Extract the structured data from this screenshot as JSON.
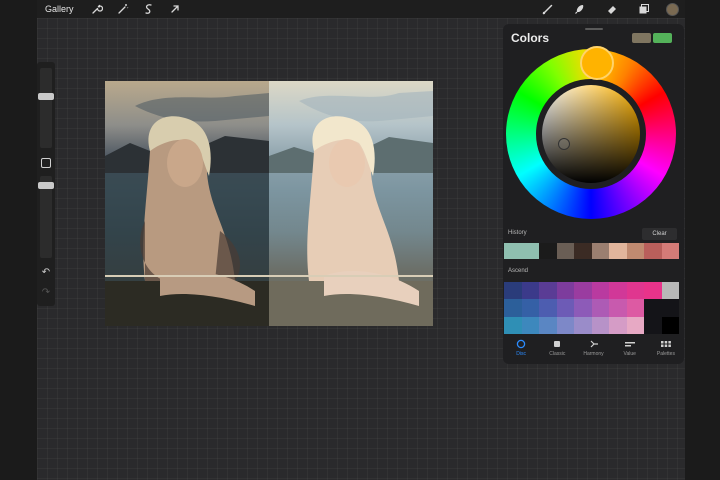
{
  "topbar": {
    "gallery_label": "Gallery",
    "left_tools": [
      {
        "name": "wrench-icon"
      },
      {
        "name": "magic-wand-icon"
      },
      {
        "name": "selection-icon"
      },
      {
        "name": "transform-arrow-icon"
      }
    ],
    "right_tools": [
      {
        "name": "brush-icon"
      },
      {
        "name": "smudge-icon"
      },
      {
        "name": "eraser-icon"
      },
      {
        "name": "layers-icon"
      }
    ],
    "current_color": "#7a6a52"
  },
  "sidebar": {
    "brush_size_icon": "slider-knob",
    "modify_icon": "square-icon",
    "undo_glyph": "↶",
    "redo_glyph": "↷"
  },
  "colors_panel": {
    "title": "Colors",
    "current_primary": "#7f7560",
    "current_secondary": "#54b25a",
    "hue_color": "#ffb300",
    "history_label": "History",
    "clear_label": "Clear",
    "history": [
      "#8fbfb0",
      "#8fbfb0",
      "#1b1b1b",
      "#6a5e55",
      "#3b2b24",
      "#9b7f70",
      "#e1b59c",
      "#c08a70",
      "#b95f5b",
      "#d47b77"
    ],
    "palette_label": "Ascend",
    "palette": [
      "#2a3c7a",
      "#3b3a8a",
      "#5a3c95",
      "#7d3c9d",
      "#9a3ca0",
      "#b93aa0",
      "#d13898",
      "#e0368f",
      "#e8338a",
      "#b8b8b8",
      "#2c5f9a",
      "#3560a6",
      "#4d5db0",
      "#6d5bb6",
      "#8d5bb8",
      "#ad5bb5",
      "#c85aae",
      "#dd5aa3",
      "#141418",
      "#141418",
      "#2f8fb5",
      "#3d88bd",
      "#5a86c3",
      "#7d88c8",
      "#9a8cc9",
      "#b792c8",
      "#d59cc6",
      "#e7a9c4",
      "#141418",
      "#000000"
    ],
    "tabs": [
      {
        "label": "Disc",
        "icon": "disc-icon",
        "active": true
      },
      {
        "label": "Classic",
        "icon": "classic-square-icon",
        "active": false
      },
      {
        "label": "Harmony",
        "icon": "harmony-icon",
        "active": false
      },
      {
        "label": "Value",
        "icon": "value-sliders-icon",
        "active": false
      },
      {
        "label": "Palettes",
        "icon": "palettes-grid-icon",
        "active": false
      }
    ]
  }
}
